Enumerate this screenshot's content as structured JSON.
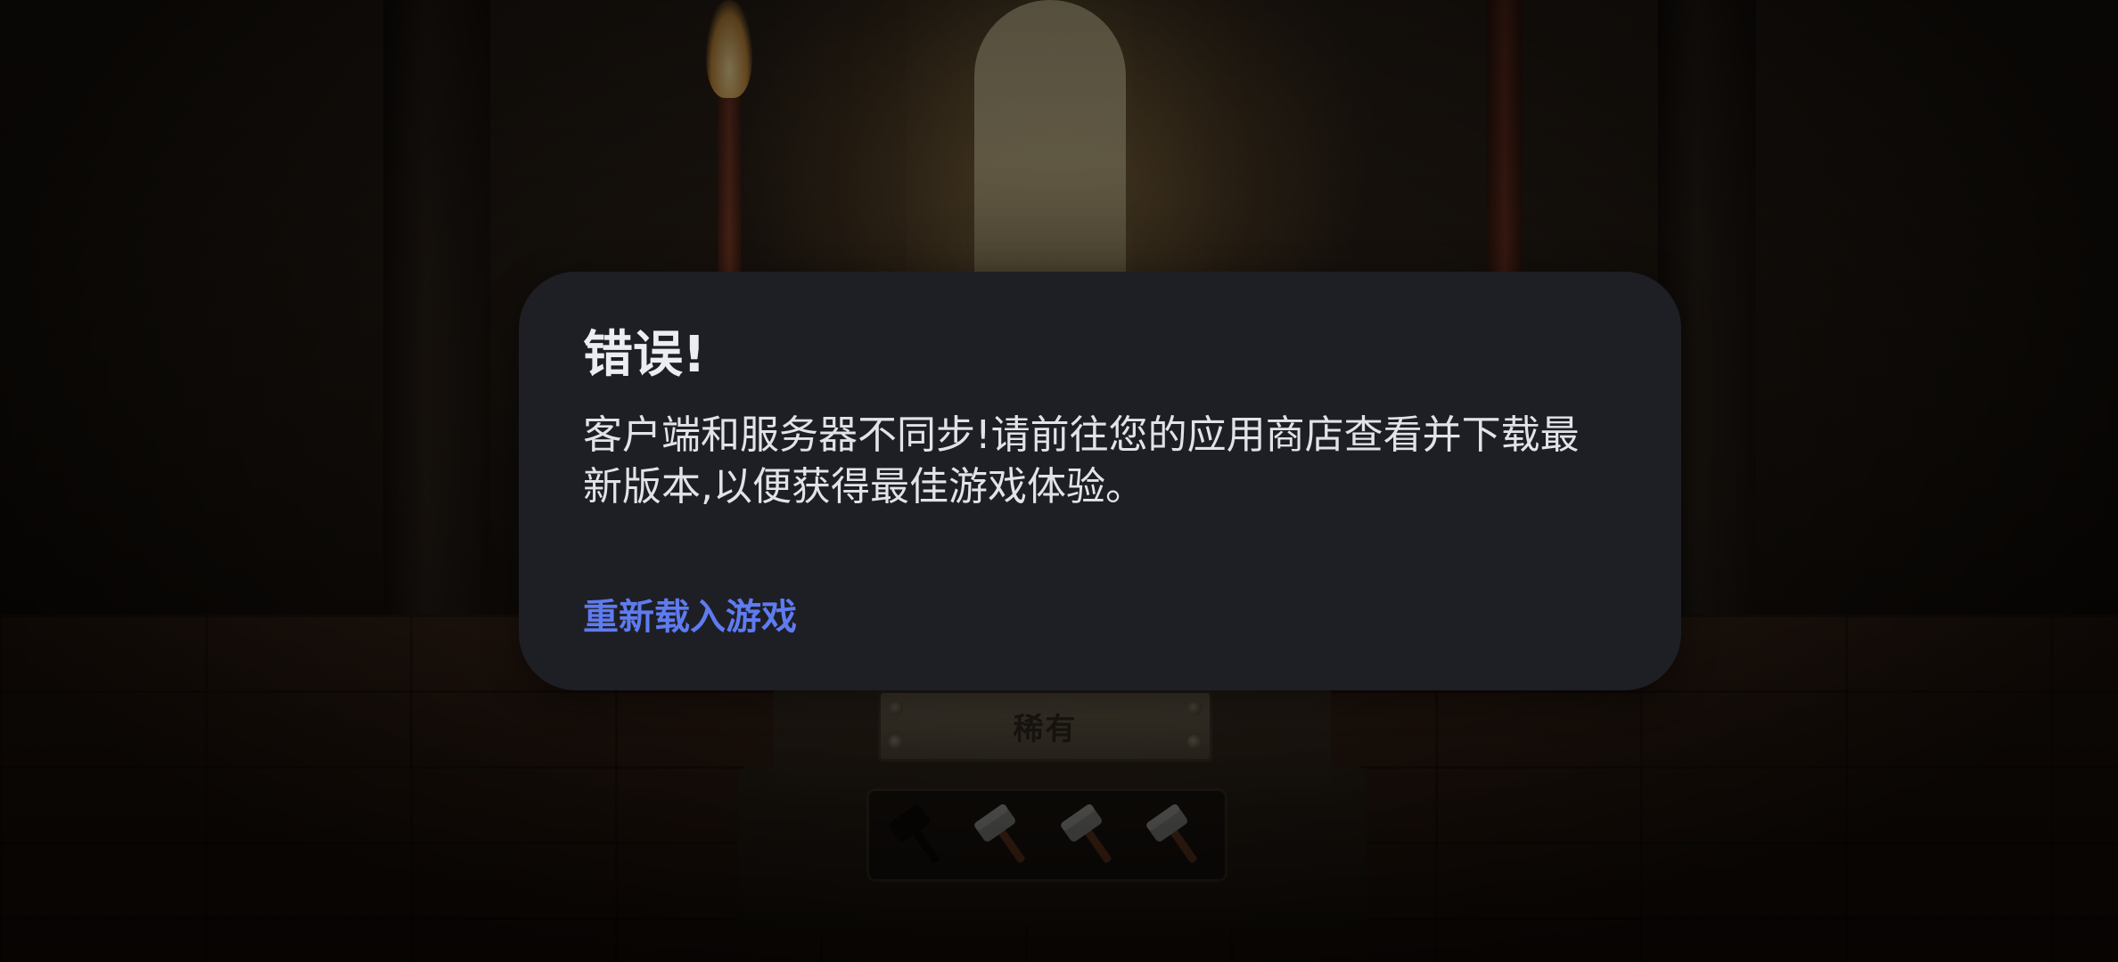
{
  "scene": {
    "rarity_label": "稀有",
    "hammers": [
      {
        "icon": "hammer-icon",
        "state": "dark"
      },
      {
        "icon": "hammer-icon",
        "state": "silver"
      },
      {
        "icon": "hammer-icon",
        "state": "silver"
      },
      {
        "icon": "hammer-icon",
        "state": "silver"
      }
    ]
  },
  "dialog": {
    "title": "错误!",
    "message": "客户端和服务器不同步!请前往您的应用商店查看并下载最新版本,以便获得最佳游戏体验。",
    "action_label": "重新载入游戏"
  },
  "colors": {
    "dialog_background": "#1e1f25",
    "action_text": "#5e7bf0",
    "title_text": "#ecedf2"
  }
}
